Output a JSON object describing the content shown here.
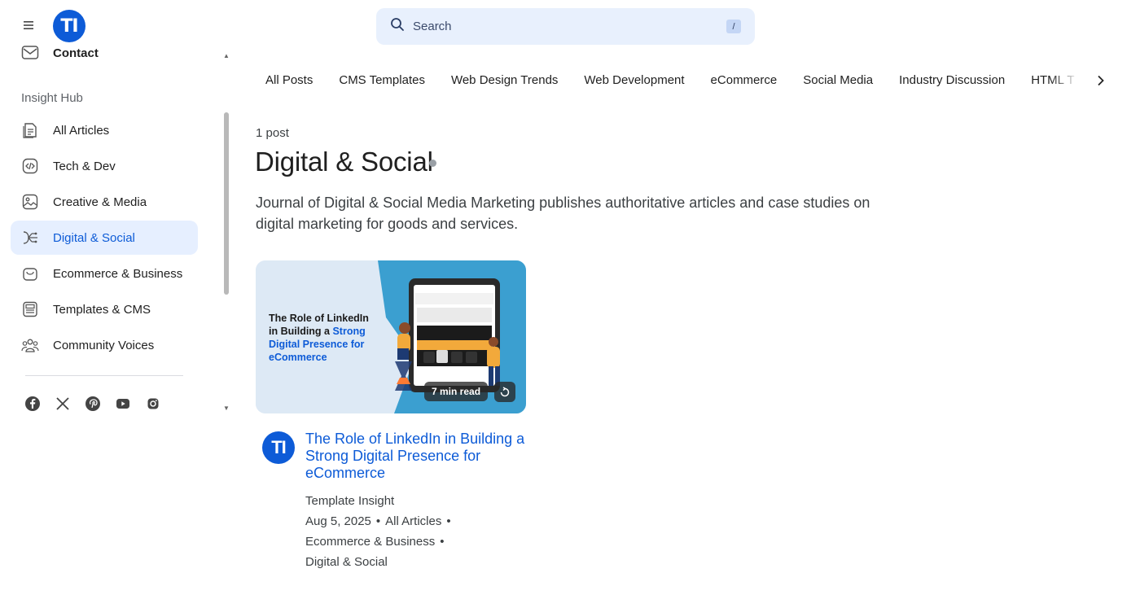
{
  "brand": {
    "logo_text": "TI"
  },
  "sidebar": {
    "contact_label": "Contact",
    "section_label": "Insight Hub",
    "items": [
      {
        "label": "All Articles",
        "icon": "articles-icon"
      },
      {
        "label": "Tech & Dev",
        "icon": "code-icon"
      },
      {
        "label": "Creative & Media",
        "icon": "image-icon"
      },
      {
        "label": "Digital & Social",
        "icon": "network-icon",
        "active": true
      },
      {
        "label": "Ecommerce & Business",
        "icon": "bag-icon"
      },
      {
        "label": "Templates & CMS",
        "icon": "template-icon"
      },
      {
        "label": "Community Voices",
        "icon": "people-icon"
      }
    ],
    "socials": [
      "facebook-icon",
      "x-icon",
      "pinterest-icon",
      "youtube-icon",
      "instagram-icon"
    ]
  },
  "search": {
    "placeholder": "Search",
    "shortcut": "/"
  },
  "tabs": [
    "All Posts",
    "CMS Templates",
    "Web Design Trends",
    "Web Development",
    "eCommerce",
    "Social Media",
    "Industry Discussion",
    "HTML T"
  ],
  "main": {
    "post_count": "1 post",
    "title": "Digital & Social",
    "description": "Journal of Digital & Social Media Marketing publishes authoritative articles and case studies on digital marketing for goods and services."
  },
  "post": {
    "image_title_plain": "The Role of LinkedIn in Building a",
    "image_title_line1": "The Role of LinkedIn",
    "image_title_line2a": "in Building a ",
    "image_title_line2b": "Strong",
    "image_title_line3": "Digital Presence for",
    "image_title_line4": "eCommerce",
    "read_time": "7 min read",
    "author_avatar": "TI",
    "title": "The Role of LinkedIn in Building a Strong Digital Presence for eCommerce",
    "author": "Template Insight",
    "date": "Aug 5, 2025",
    "categories": [
      "All Articles",
      "Ecommerce & Business",
      "Digital & Social"
    ]
  },
  "colors": {
    "accent": "#0d5bd7",
    "active_bg": "#e6efff",
    "search_bg": "#e8f0fd"
  }
}
